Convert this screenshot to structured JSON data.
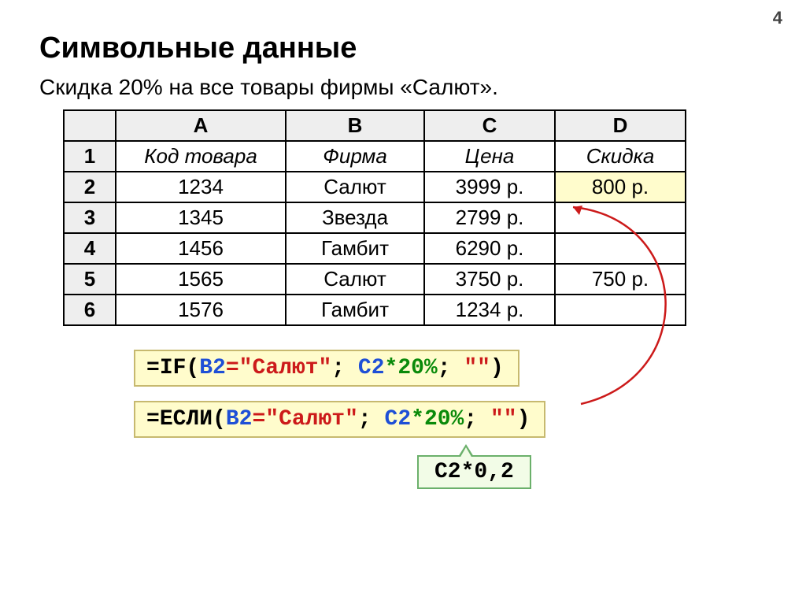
{
  "page_number": "4",
  "title": "Символьные данные",
  "subtitle": "Скидка 20% на все товары фирмы «Салют».",
  "table": {
    "columns": [
      "A",
      "B",
      "C",
      "D"
    ],
    "header_row": {
      "n": "1",
      "a": "Код товара",
      "b": "Фирма",
      "c": "Цена",
      "d": "Скидка"
    },
    "rows": [
      {
        "n": "2",
        "a": "1234",
        "b": "Салют",
        "c": "3999 р.",
        "d": "800 р."
      },
      {
        "n": "3",
        "a": "1345",
        "b": "Звезда",
        "c": "2799 р.",
        "d": ""
      },
      {
        "n": "4",
        "a": "1456",
        "b": "Гамбит",
        "c": "6290 р.",
        "d": ""
      },
      {
        "n": "5",
        "a": "1565",
        "b": "Салют",
        "c": "3750 р.",
        "d": "750 р."
      },
      {
        "n": "6",
        "a": "1576",
        "b": "Гамбит",
        "c": "1234 р.",
        "d": ""
      }
    ]
  },
  "formula1": {
    "parts": [
      {
        "t": "=",
        "c": "black"
      },
      {
        "t": "IF",
        "c": "black"
      },
      {
        "t": "(",
        "c": "black"
      },
      {
        "t": "B2",
        "c": "blue"
      },
      {
        "t": "=",
        "c": "red"
      },
      {
        "t": "\"Салют\"",
        "c": "red"
      },
      {
        "t": ";",
        "c": "black"
      },
      {
        "t": " ",
        "c": "black"
      },
      {
        "t": "C2",
        "c": "blue"
      },
      {
        "t": "*",
        "c": "green"
      },
      {
        "t": "20%",
        "c": "green"
      },
      {
        "t": ";",
        "c": "black"
      },
      {
        "t": " ",
        "c": "black"
      },
      {
        "t": "\"\"",
        "c": "red"
      },
      {
        "t": ")",
        "c": "black"
      }
    ]
  },
  "formula2": {
    "parts": [
      {
        "t": "=",
        "c": "black"
      },
      {
        "t": "ЕСЛИ",
        "c": "black"
      },
      {
        "t": "(",
        "c": "black"
      },
      {
        "t": "B2",
        "c": "blue"
      },
      {
        "t": "=",
        "c": "red"
      },
      {
        "t": "\"Салют\"",
        "c": "red"
      },
      {
        "t": ";",
        "c": "black"
      },
      {
        "t": " ",
        "c": "black"
      },
      {
        "t": "C2",
        "c": "blue"
      },
      {
        "t": "*",
        "c": "green"
      },
      {
        "t": "20%",
        "c": "green"
      },
      {
        "t": ";",
        "c": "black"
      },
      {
        "t": " ",
        "c": "black"
      },
      {
        "t": "\"\"",
        "c": "red"
      },
      {
        "t": ")",
        "c": "black"
      }
    ]
  },
  "callout_text": "C2*0,2"
}
